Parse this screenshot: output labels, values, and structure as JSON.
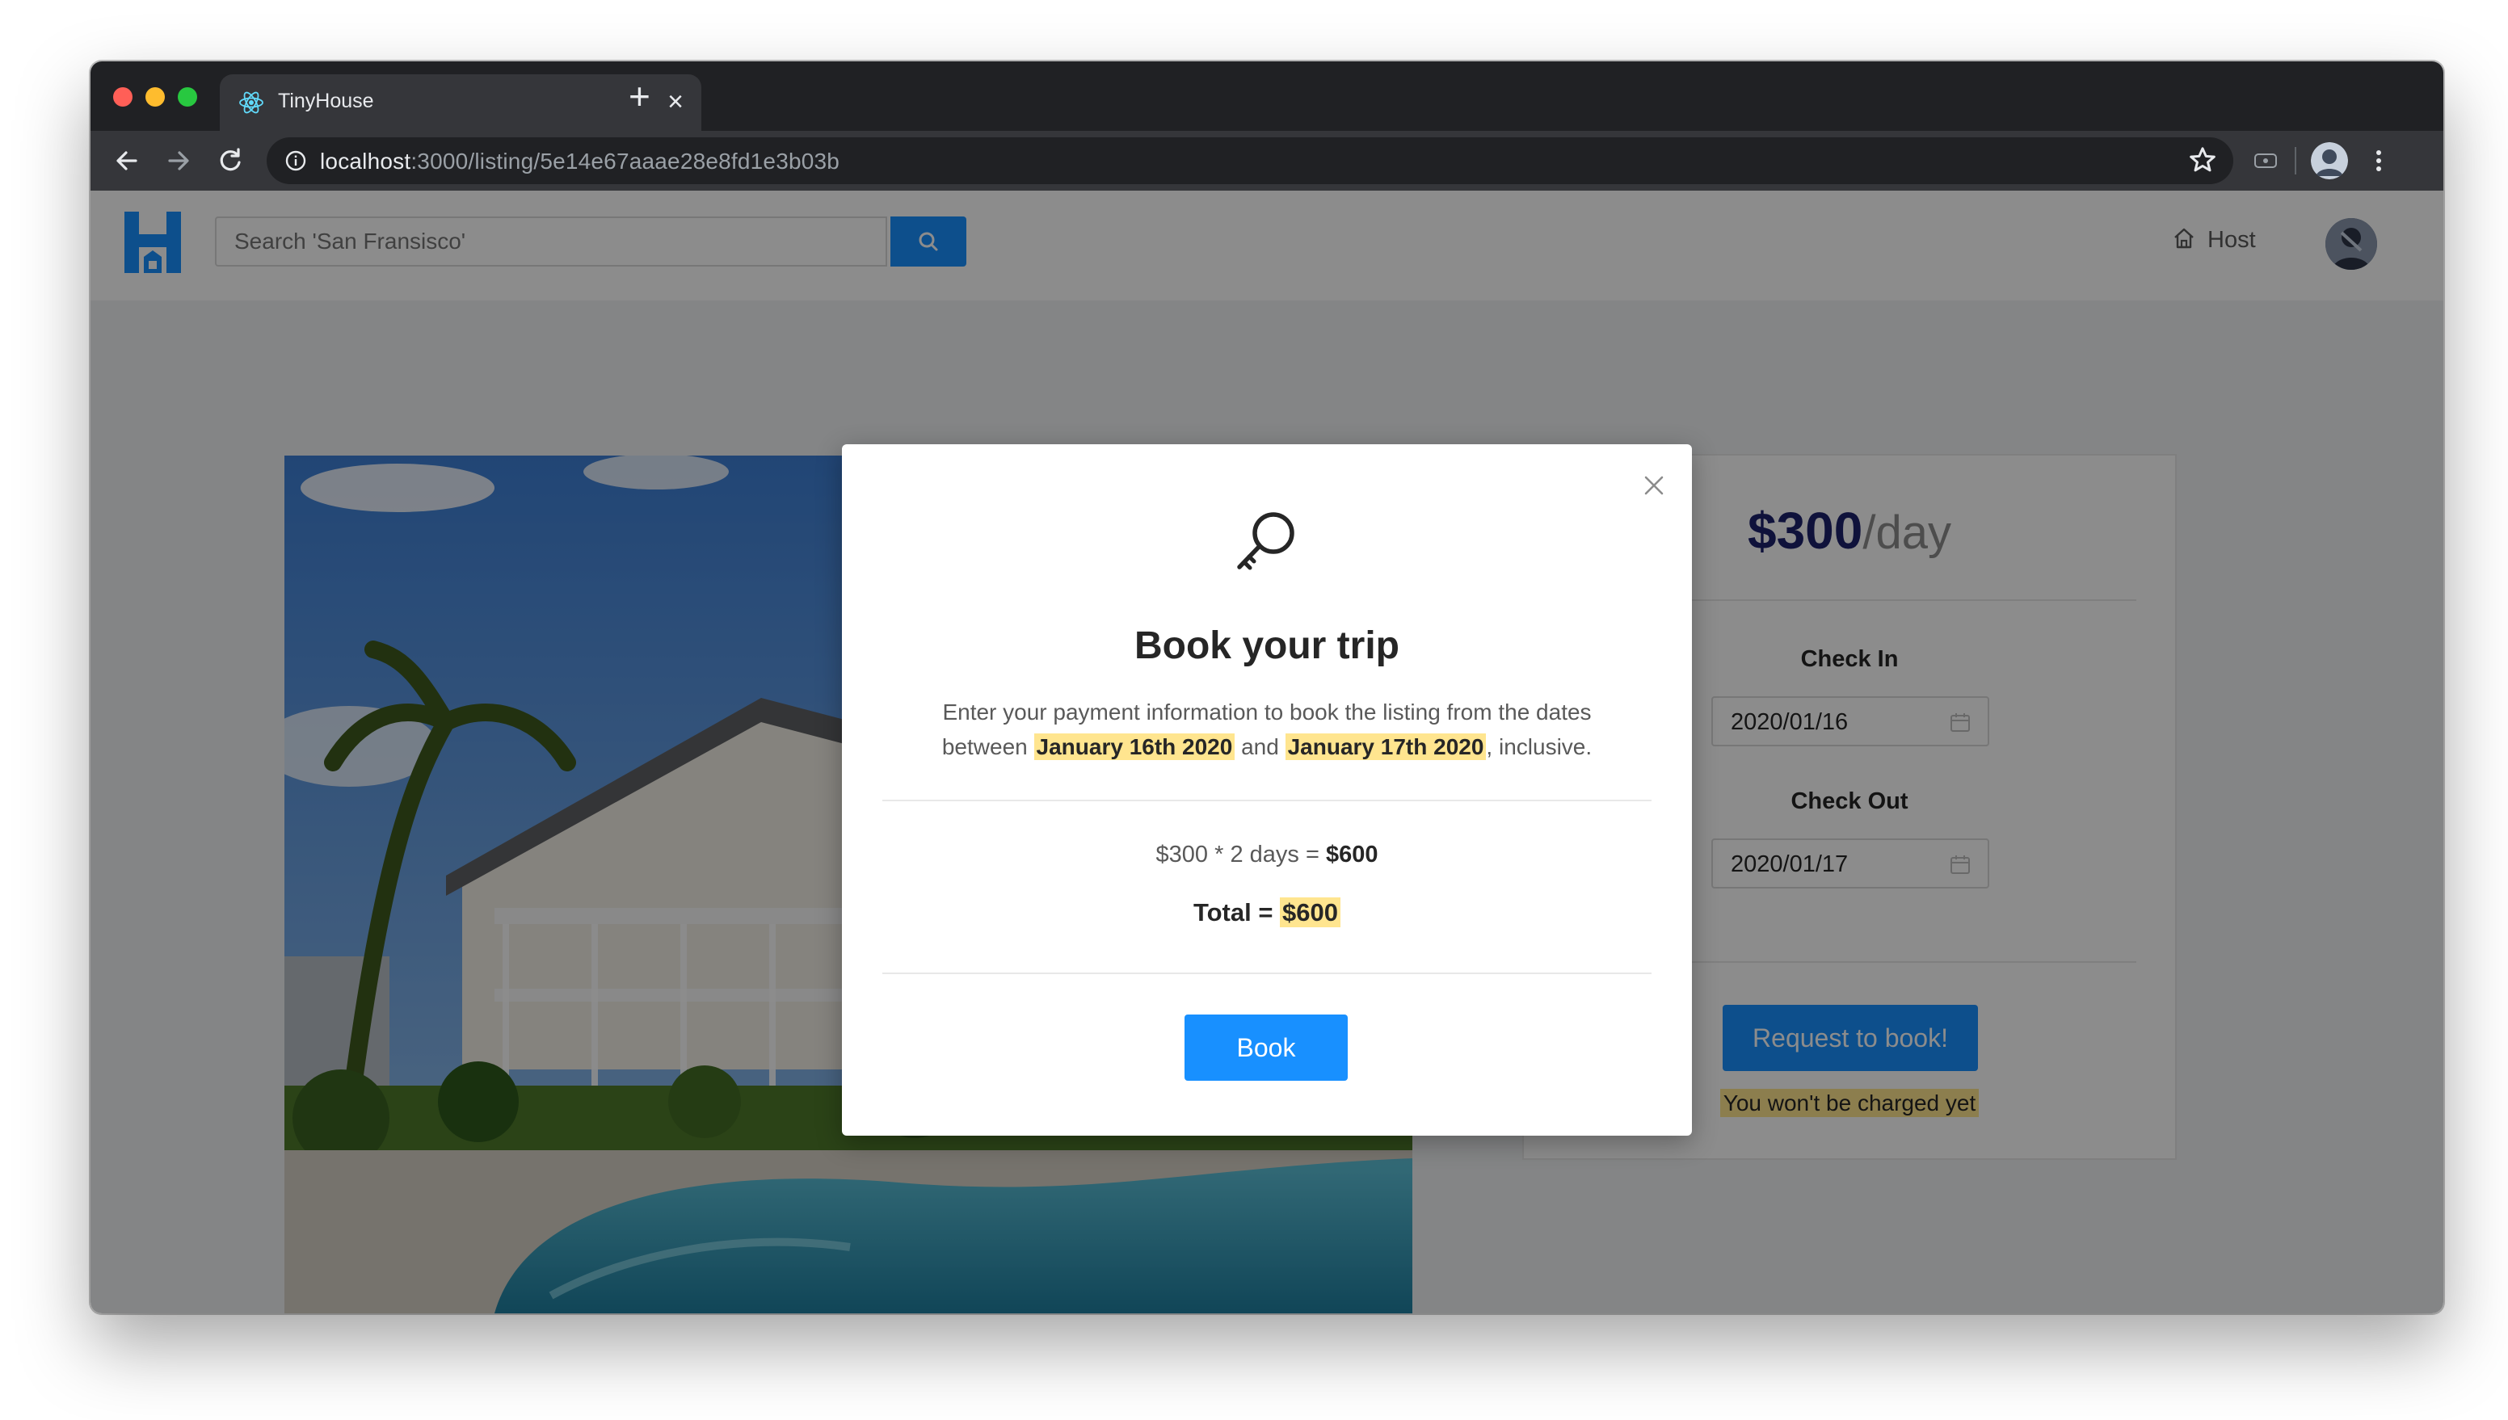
{
  "browser": {
    "tab_title": "TinyHouse",
    "tab_close_label": "×",
    "new_tab_label": "+",
    "url_host": "localhost",
    "url_path": ":3000/listing/5e14e67aaae28e8fd1e3b03b"
  },
  "header": {
    "search_placeholder": "Search 'San Fransisco'",
    "host_label": "Host",
    "accent_color": "#1890ff"
  },
  "booking": {
    "price": "$300",
    "price_unit": "/day",
    "check_in_label": "Check In",
    "check_in_value": "2020/01/16",
    "check_out_label": "Check Out",
    "check_out_value": "2020/01/17",
    "request_button": "Request to book!",
    "note": "You won't be charged yet"
  },
  "modal": {
    "title": "Book your trip",
    "desc_intro": "Enter your payment information to book the listing from the dates between",
    "date_start": "January 16th 2020",
    "desc_and": "and",
    "date_end": "January 17th 2020",
    "desc_end": ", inclusive.",
    "calc_text": "$300 * 2 days = ",
    "calc_value": "$600",
    "total_label": "Total = ",
    "total_value": "$600",
    "book_button": "Book"
  }
}
